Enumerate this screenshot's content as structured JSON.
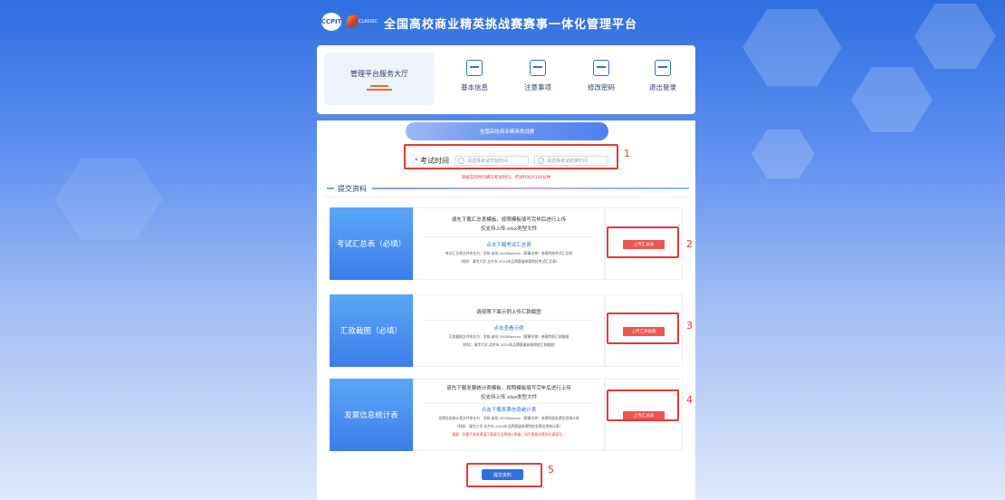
{
  "header": {
    "ccpit_logo": "CCPIT",
    "classic_logo": "CLASSIC",
    "title": "全国高校商业精英挑战赛赛事一体化管理平台"
  },
  "nav": {
    "hall_label": "管理平台服务大厅",
    "items": [
      {
        "label": "基本信息",
        "icon": "profile-icon"
      },
      {
        "label": "注意事项",
        "icon": "notice-icon"
      },
      {
        "label": "修改密码",
        "icon": "edit-password-icon"
      },
      {
        "label": "退出登录",
        "icon": "logout-icon"
      }
    ]
  },
  "main": {
    "banner": "全国高校商业精英挑战赛",
    "exam_time_label": "考试时间",
    "start_placeholder": "请选择考试开始时间",
    "end_placeholder": "请选择考试结束时间",
    "hint": "请按实际时间填写考试时间，考试时间为120分钟",
    "section_title": "提交资料",
    "blocks": [
      {
        "title": "考试汇总表（必填）",
        "line1": "请先下载汇总表模板，按照模板填写完毕后进行上传",
        "line2": "仅支持上传.xlsx类型文件",
        "download": "点击下载考试汇总表",
        "note1": "考试汇总表文件命名为：学校-省份-2000Boxxxx（赛事名称）参赛院校考试汇总表",
        "note2": "（例如：清华大学-北京市-2024年品牌赛道参赛院校考试汇总表）",
        "button": "上传汇总表",
        "warn": ""
      },
      {
        "title": "汇款截图（必填）",
        "line1": "请按照下面示例上传汇款截图",
        "line2": "",
        "download": "点击查看示例",
        "note1": "汇款截图文件命名为：学校-省份-2000Boxxxx（赛事名称）参赛院校汇款截图",
        "note2": "（例如：清华大学-北京市-2024年品牌赛道参赛院校汇款截图）",
        "button": "上传汇款截图",
        "warn": ""
      },
      {
        "title": "发票信息统计表",
        "line1": "请先下载发票统计表模板，按照模板填写完毕后进行上传",
        "line2": "仅支持上传.xlsx类型文件",
        "download": "点击下载发票信息统计表",
        "note1": "发票信息统计表文件命名为：学校-省份-2000Boxxxx（赛事名称）参赛院校发票信息统计表",
        "note2": "（例如：清华大学-北京市-2024年品牌赛道参赛院校发票信息统计表）",
        "warn": "重要：如需开具发票请下载填写发票统计表格，如不需要发票则无需填写。",
        "button": "上传汇总表"
      }
    ],
    "submit": "提交资料"
  },
  "annotations": [
    "1",
    "2",
    "3",
    "4",
    "5"
  ],
  "colors": {
    "primary": "#2f6fe0",
    "danger": "#f0544f",
    "annotation": "#e53935"
  }
}
